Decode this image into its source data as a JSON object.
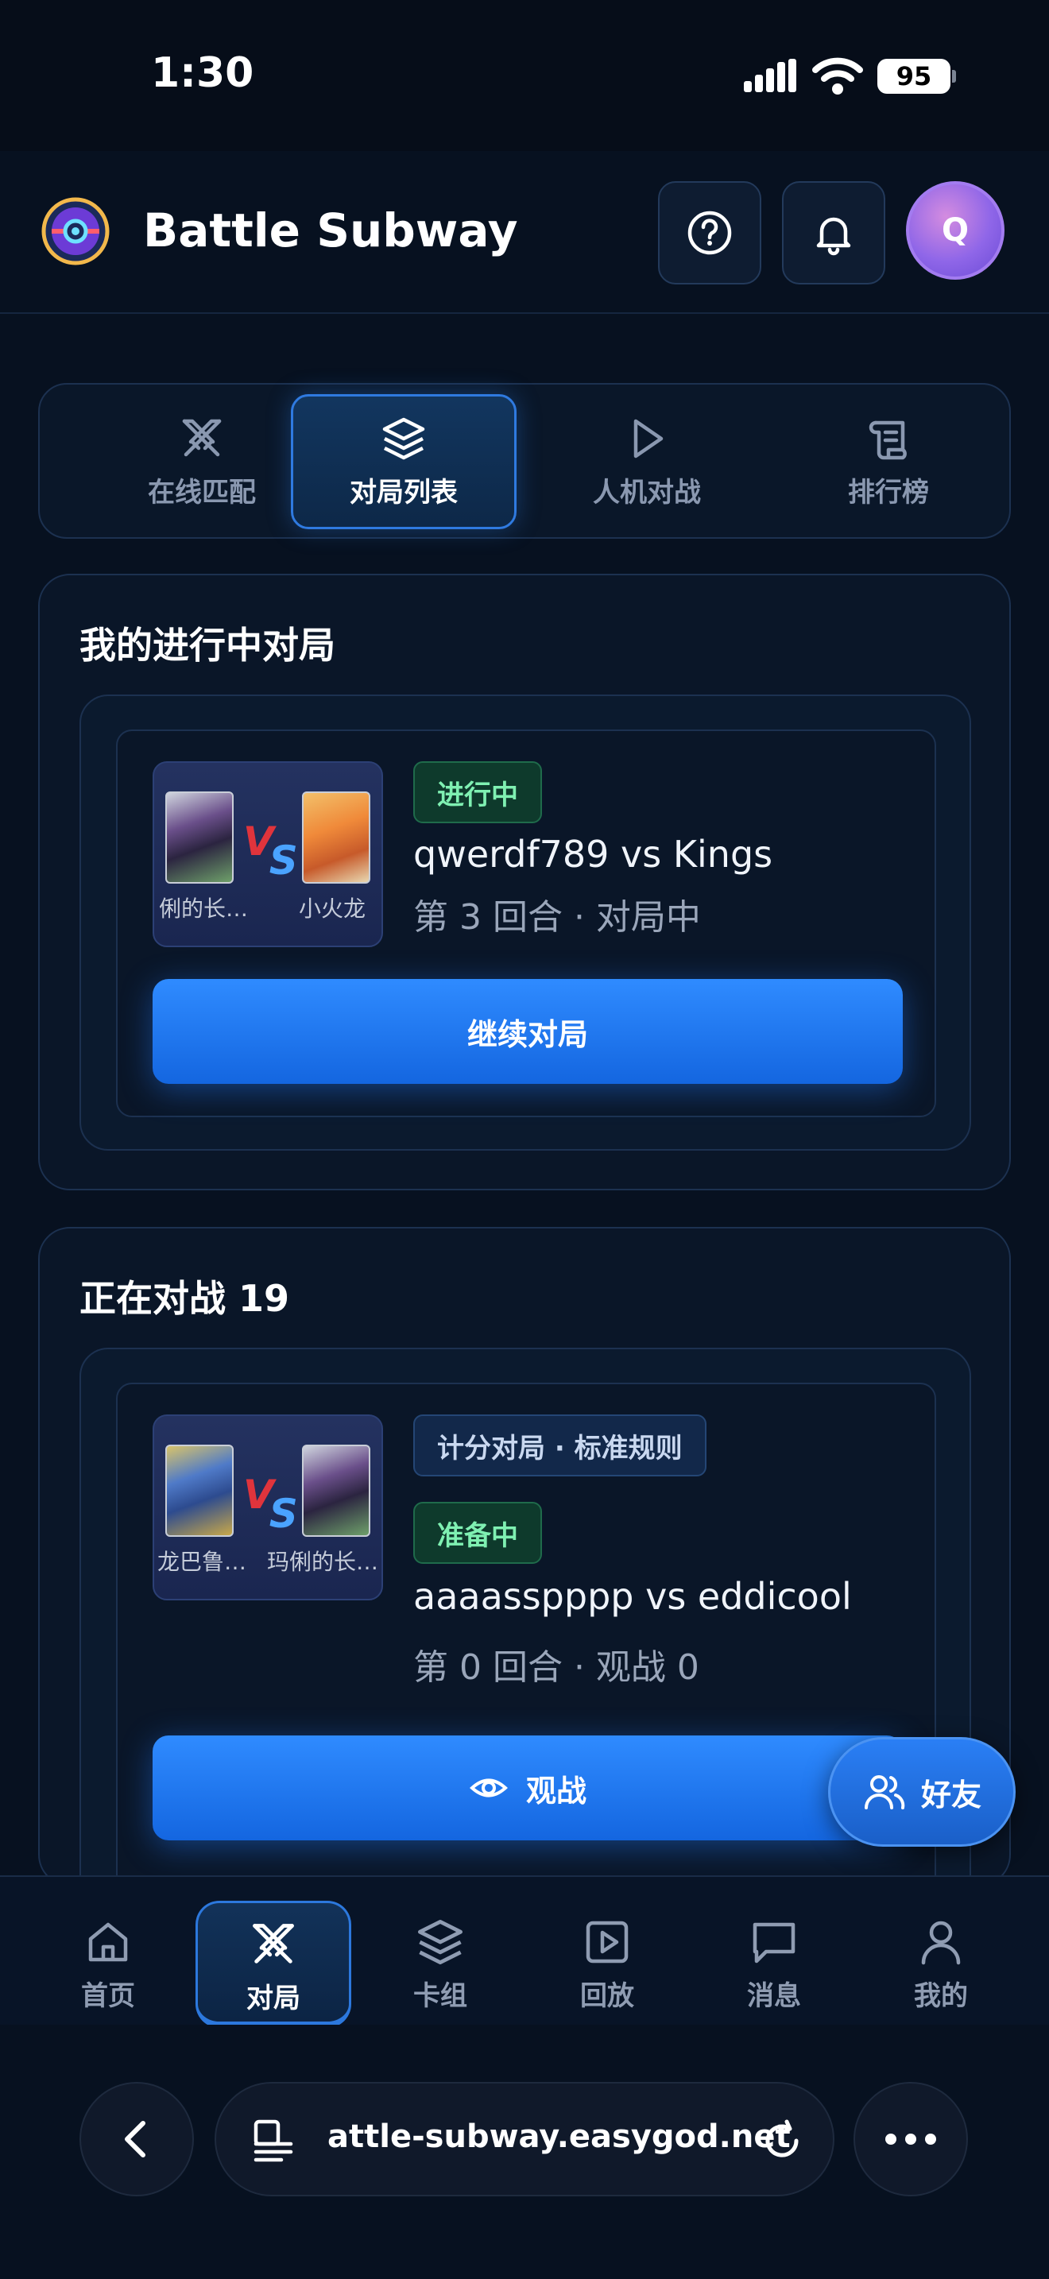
{
  "status_bar": {
    "time": "1:30",
    "battery": "95"
  },
  "header": {
    "title": "Battle Subway",
    "avatar_letter": "Q"
  },
  "tabs": [
    {
      "label": "在线匹配",
      "icon": "crossed-swords-icon"
    },
    {
      "label": "对局列表",
      "icon": "layers-icon",
      "active": true
    },
    {
      "label": "人机对战",
      "icon": "play-icon"
    },
    {
      "label": "排行榜",
      "icon": "scroll-icon"
    }
  ],
  "my_games": {
    "title": "我的进行中对局",
    "match": {
      "left_card": "俐的长…",
      "right_card": "小火龙",
      "vs_v": "V",
      "vs_s": "S",
      "status": "进行中",
      "title": "qwerdf789 vs Kings",
      "subtitle": "第 3 回合 · 对局中",
      "button": "继续对局"
    }
  },
  "live_games": {
    "title": "正在对战 19",
    "match": {
      "left_card": "龙巴鲁…",
      "right_card": "玛俐的长…",
      "vs_v": "V",
      "vs_s": "S",
      "mode": "计分对局 · 标准规则",
      "status": "准备中",
      "title": "aaaasspppp vs eddicool",
      "subtitle": "第 0 回合 · 观战 0",
      "button": "观战"
    }
  },
  "friends_button": "好友",
  "bottom_nav": [
    {
      "label": "首页",
      "icon": "home-icon"
    },
    {
      "label": "对局",
      "icon": "crossed-swords-icon",
      "active": true
    },
    {
      "label": "卡组",
      "icon": "layers-icon"
    },
    {
      "label": "回放",
      "icon": "replay-icon"
    },
    {
      "label": "消息",
      "icon": "message-icon"
    },
    {
      "label": "我的",
      "icon": "user-icon"
    }
  ],
  "browser": {
    "url": "attle-subway.easygod.net"
  },
  "colors": {
    "accent": "#2f8bff",
    "background": "#071120",
    "status_green": "#7ff0b2"
  }
}
